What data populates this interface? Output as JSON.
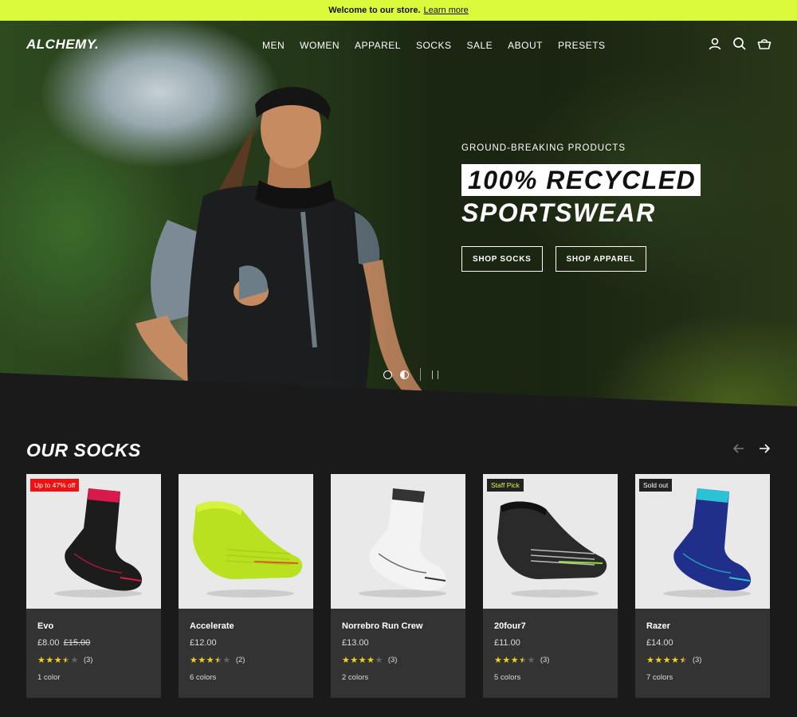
{
  "announcement": {
    "text": "Welcome to our store.",
    "link": "Learn more"
  },
  "header": {
    "logo": "ALCHEMY.",
    "menu": [
      "MEN",
      "WOMEN",
      "APPAREL",
      "SOCKS",
      "SALE",
      "ABOUT",
      "PRESETS"
    ],
    "icons": [
      "account-icon",
      "search-icon",
      "basket-icon"
    ]
  },
  "hero": {
    "eyebrow": "GROUND-BREAKING PRODUCTS",
    "headline_line1": "100% RECYCLED",
    "headline_line2": "SPORTSWEAR",
    "cta_primary": "SHOP SOCKS",
    "cta_secondary": "SHOP APPAREL",
    "slides": 2,
    "active_slide": 2
  },
  "socks_section": {
    "title": "OUR SOCKS",
    "products": [
      {
        "name": "Evo",
        "price": "£8.00",
        "compare_price": "£15.00",
        "rating": 3.5,
        "reviews": "(3)",
        "colors": "1 color",
        "badge": "Up to 47% off",
        "badge_type": "sale",
        "sock_color": "#1c1c1c",
        "accent": "#d8194a"
      },
      {
        "name": "Accelerate",
        "price": "£12.00",
        "compare_price": "",
        "rating": 3.5,
        "reviews": "(2)",
        "colors": "6 colors",
        "badge": "",
        "badge_type": "",
        "sock_color": "#b8e21f",
        "accent": "#e84a2a"
      },
      {
        "name": "Norrebro Run Crew",
        "price": "£13.00",
        "compare_price": "",
        "rating": 4,
        "reviews": "(3)",
        "colors": "2 colors",
        "badge": "",
        "badge_type": "",
        "sock_color": "#f3f3f3",
        "accent": "#333333"
      },
      {
        "name": "20four7",
        "price": "£11.00",
        "compare_price": "",
        "rating": 3.5,
        "reviews": "(3)",
        "colors": "5 colors",
        "badge": "Staff Pick",
        "badge_type": "pick",
        "sock_color": "#2a2a2a",
        "accent": "#8fe02f"
      },
      {
        "name": "Razer",
        "price": "£14.00",
        "compare_price": "",
        "rating": 4.5,
        "reviews": "(3)",
        "colors": "7 colors",
        "badge": "Sold out",
        "badge_type": "sold",
        "sock_color": "#1f2f8a",
        "accent": "#2ac3d6"
      }
    ]
  },
  "colors": {
    "accent": "#dcfa3c",
    "background": "#1a1a1a",
    "card": "#333333",
    "star": "#f2d21f",
    "sale": "#ee1111"
  }
}
